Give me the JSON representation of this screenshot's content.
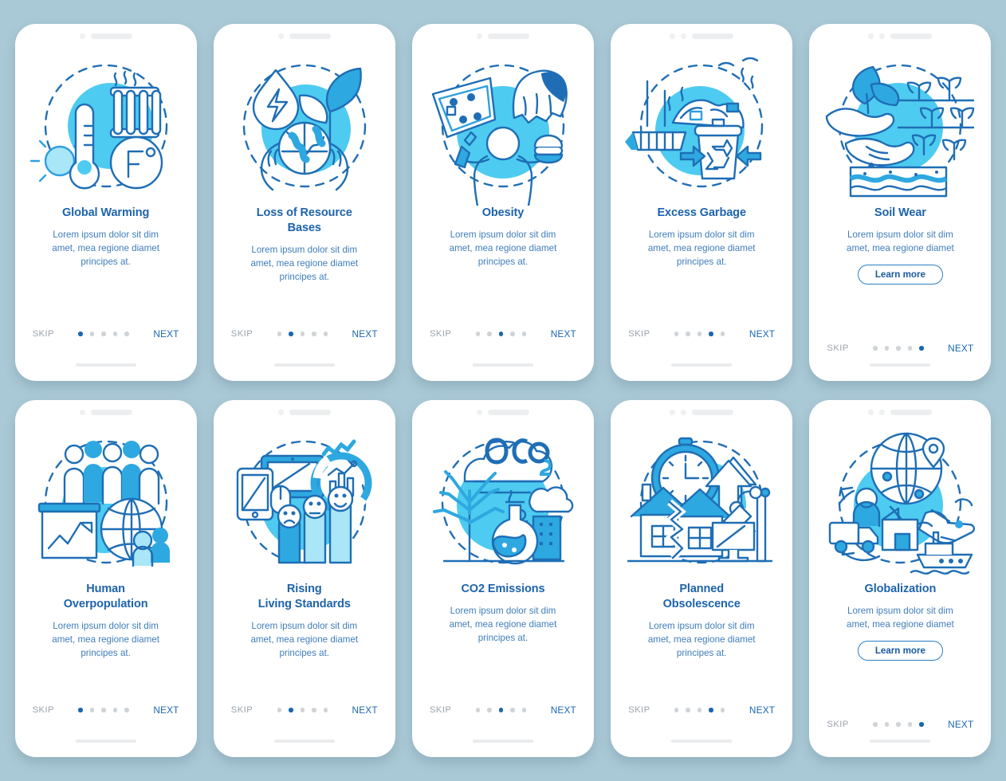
{
  "background_color": "#aac9d6",
  "palette": {
    "title_blue": "#1d63ab",
    "body_blue": "#3f7dba",
    "accent_cyan": "#4ecbf0",
    "outline_blue": "#1f6eb5",
    "next_blue": "#1a66b0",
    "skip_gray": "#9aa3ab",
    "dot_inactive": "#cfd4d8"
  },
  "common": {
    "skip_label": "SKIP",
    "next_label": "NEXT",
    "learn_more_label": "Learn more",
    "body_text_3line": "Lorem ipsum dolor sit dim\namet, mea regione diamet\nprincipes at.",
    "body_text_2line": "Lorem ipsum dolor sit dim\namet, mea regione diamet",
    "total_dots": 5
  },
  "cards": [
    {
      "id": "global-warming",
      "title": "Global Warming",
      "body": "Lorem ipsum dolor sit dim\namet, mea regione diamet\nprincipes at.",
      "skip": "SKIP",
      "next": "NEXT",
      "active_dot": 1,
      "dots": 5,
      "has_learn_more": false,
      "learn_more": "",
      "camera_dots": 1,
      "illustration": "thermometer-radiator-fahrenheit-icon"
    },
    {
      "id": "loss-of-resource-bases",
      "title": "Loss of Resource\nBases",
      "body": "Lorem ipsum dolor sit dim\namet, mea regione diamet\nprincipes at.",
      "skip": "SKIP",
      "next": "NEXT",
      "active_dot": 2,
      "dots": 5,
      "has_learn_more": false,
      "learn_more": "",
      "camera_dots": 1,
      "illustration": "water-drop-earth-leaf-icon"
    },
    {
      "id": "obesity",
      "title": "Obesity",
      "body": "Lorem ipsum dolor sit dim\namet, mea regione diamet\nprincipes at.",
      "skip": "SKIP",
      "next": "NEXT",
      "active_dot": 3,
      "dots": 5,
      "has_learn_more": false,
      "learn_more": "",
      "camera_dots": 1,
      "illustration": "pizza-burger-person-icon"
    },
    {
      "id": "excess-garbage",
      "title": "Excess Garbage",
      "body": "Lorem ipsum dolor sit dim\namet, mea regione diamet\nprincipes at.",
      "skip": "SKIP",
      "next": "NEXT",
      "active_dot": 4,
      "dots": 5,
      "has_learn_more": false,
      "learn_more": "",
      "camera_dots": 2,
      "illustration": "broom-trash-recycle-icon"
    },
    {
      "id": "soil-wear",
      "title": "Soil Wear",
      "body": "Lorem ipsum dolor sit dim\namet, mea regione diamet",
      "skip": "SKIP",
      "next": "NEXT",
      "active_dot": 5,
      "dots": 5,
      "has_learn_more": true,
      "learn_more": "Learn more",
      "camera_dots": 2,
      "illustration": "hand-sprout-soil-icon"
    },
    {
      "id": "human-overpopulation",
      "title": "Human\nOverpopulation",
      "body": "Lorem ipsum dolor sit dim\namet, mea regione diamet\nprincipes at.",
      "skip": "SKIP",
      "next": "NEXT",
      "active_dot": 1,
      "dots": 5,
      "has_learn_more": false,
      "learn_more": "",
      "camera_dots": 1,
      "illustration": "people-chart-globe-icon"
    },
    {
      "id": "rising-living-standards",
      "title": "Rising\nLiving Standards",
      "body": "Lorem ipsum dolor sit dim\namet, mea regione diamet\nprincipes at.",
      "skip": "SKIP",
      "next": "NEXT",
      "active_dot": 2,
      "dots": 5,
      "has_learn_more": false,
      "learn_more": "",
      "camera_dots": 1,
      "illustration": "devices-analytics-faces-icon"
    },
    {
      "id": "co2-emissions",
      "title": "CO2 Emissions",
      "body": "Lorem ipsum dolor sit dim\namet, mea regione diamet\nprincipes at.",
      "skip": "SKIP",
      "next": "NEXT",
      "active_dot": 3,
      "dots": 5,
      "has_learn_more": false,
      "learn_more": "",
      "camera_dots": 1,
      "illustration": "co2-cloud-tree-factory-icon"
    },
    {
      "id": "planned-obsolescence",
      "title": "Planned\nObsolescence",
      "body": "Lorem ipsum dolor sit dim\namet, mea regione diamet\nprincipes at.",
      "skip": "SKIP",
      "next": "NEXT",
      "active_dot": 4,
      "dots": 5,
      "has_learn_more": false,
      "learn_more": "",
      "camera_dots": 2,
      "illustration": "clock-house-monitor-icon"
    },
    {
      "id": "globalization",
      "title": "Globalization",
      "body": "Lorem ipsum dolor sit dim\namet, mea regione diamet",
      "skip": "SKIP",
      "next": "NEXT",
      "active_dot": 5,
      "dots": 5,
      "has_learn_more": true,
      "learn_more": "Learn more",
      "camera_dots": 2,
      "illustration": "globe-truck-plane-ship-icon"
    }
  ]
}
